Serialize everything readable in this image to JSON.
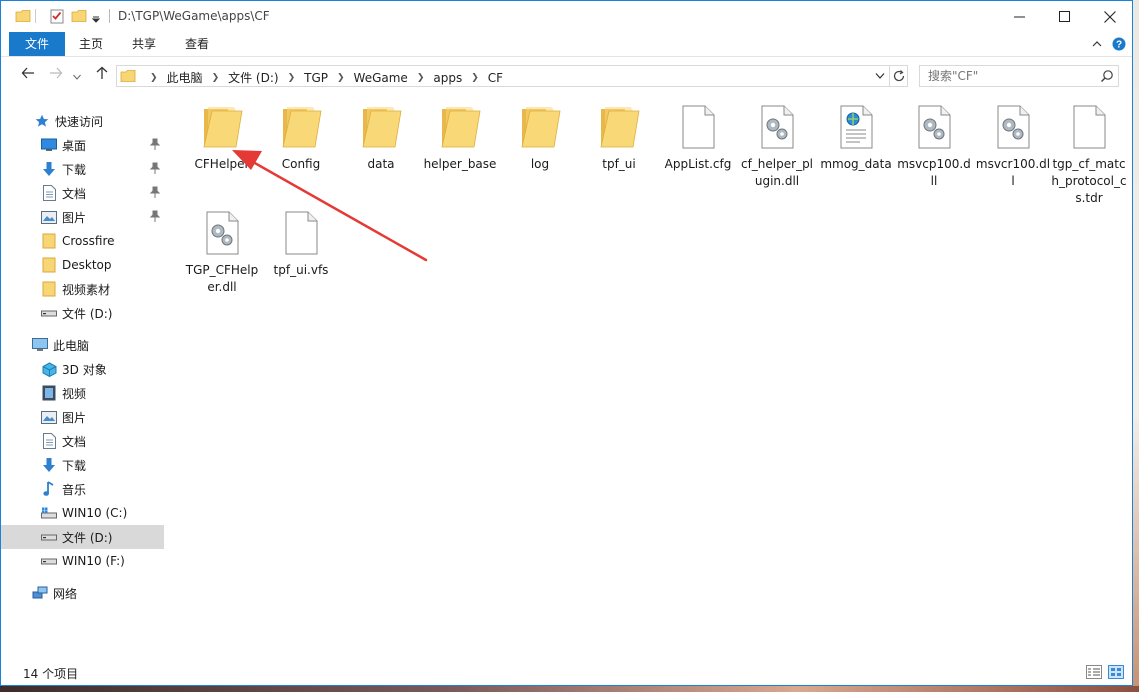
{
  "window": {
    "title": "D:\\TGP\\WeGame\\apps\\CF"
  },
  "ribbon": {
    "tabs": [
      "文件",
      "主页",
      "共享",
      "查看"
    ]
  },
  "address": {
    "crumbs": [
      "此电脑",
      "文件 (D:)",
      "TGP",
      "WeGame",
      "apps",
      "CF"
    ]
  },
  "search": {
    "placeholder": "搜索\"CF\""
  },
  "nav": {
    "quick_access": "快速访问",
    "quick_items": [
      "桌面",
      "下载",
      "文档",
      "图片",
      "Crossfire",
      "Desktop",
      "视频素材",
      "文件 (D:)"
    ],
    "this_pc": "此电脑",
    "pc_items": [
      "3D 对象",
      "视频",
      "图片",
      "文档",
      "下载",
      "音乐",
      "WIN10 (C:)",
      "文件 (D:)",
      "WIN10 (F:)"
    ],
    "network": "网络"
  },
  "files": [
    {
      "name": "CFHelper",
      "type": "folder"
    },
    {
      "name": "Config",
      "type": "folder"
    },
    {
      "name": "data",
      "type": "folder"
    },
    {
      "name": "helper_base",
      "type": "folder"
    },
    {
      "name": "log",
      "type": "folder"
    },
    {
      "name": "tpf_ui",
      "type": "folder"
    },
    {
      "name": "AppList.cfg",
      "type": "file"
    },
    {
      "name": "cf_helper_plugin.dll",
      "type": "dll"
    },
    {
      "name": "mmog_data",
      "type": "web"
    },
    {
      "name": "msvcp100.dll",
      "type": "dll"
    },
    {
      "name": "msvcr100.dll",
      "type": "dll"
    },
    {
      "name": "tgp_cf_match_protocol_cs.tdr",
      "type": "file"
    },
    {
      "name": "TGP_CFHelper.dll",
      "type": "dll"
    },
    {
      "name": "tpf_ui.vfs",
      "type": "file"
    }
  ],
  "status": {
    "count": "14 个项目"
  },
  "colors": {
    "accent": "#1979ca",
    "folder": "#f8d675",
    "arrow": "#e53935"
  }
}
